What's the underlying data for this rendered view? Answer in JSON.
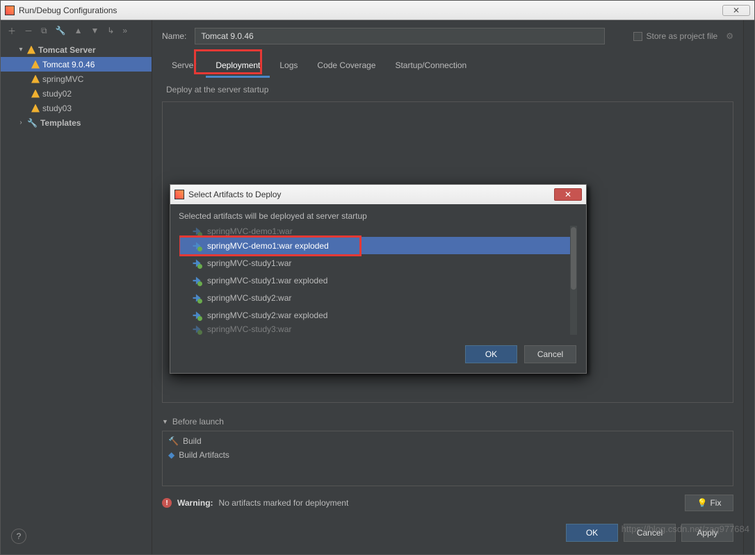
{
  "window": {
    "title": "Run/Debug Configurations",
    "close_glyph": "✕"
  },
  "sidebar": {
    "toolbar_glyphs": [
      "＋",
      "－",
      "⧉",
      "🔧",
      "▲",
      "▼",
      "↳",
      "»"
    ],
    "root": {
      "label": "Tomcat Server",
      "expanded": true
    },
    "configs": [
      {
        "label": "Tomcat 9.0.46",
        "selected": true
      },
      {
        "label": "springMVC",
        "selected": false
      },
      {
        "label": "study02",
        "selected": false
      },
      {
        "label": "study03",
        "selected": false
      }
    ],
    "templates": {
      "label": "Templates",
      "expanded": false
    }
  },
  "header": {
    "name_label": "Name:",
    "name_value": "Tomcat 9.0.46",
    "store_label": "Store as project file",
    "gear_glyph": "⚙"
  },
  "tabs": [
    {
      "label": "Server",
      "active": false
    },
    {
      "label": "Deployment",
      "active": true
    },
    {
      "label": "Logs",
      "active": false
    },
    {
      "label": "Code Coverage",
      "active": false
    },
    {
      "label": "Startup/Connection",
      "active": false
    }
  ],
  "deployment": {
    "section_label": "Deploy at the server startup"
  },
  "before_launch": {
    "title": "Before launch",
    "items": [
      {
        "label": "Build",
        "icon": "hammer"
      },
      {
        "label": "Build Artifacts",
        "icon": "artifact"
      }
    ]
  },
  "warning": {
    "bold": "Warning:",
    "text": "No artifacts marked for deployment",
    "fix_label": "Fix"
  },
  "buttons": {
    "ok": "OK",
    "cancel": "Cancel",
    "apply": "Apply",
    "help_glyph": "?"
  },
  "modal": {
    "title": "Select Artifacts to Deploy",
    "subtitle": "Selected artifacts will be deployed at server startup",
    "items": [
      {
        "label": "springMVC-demo1:war",
        "selected": false,
        "cut_top": true
      },
      {
        "label": "springMVC-demo1:war exploded",
        "selected": true
      },
      {
        "label": "springMVC-study1:war",
        "selected": false
      },
      {
        "label": "springMVC-study1:war exploded",
        "selected": false
      },
      {
        "label": "springMVC-study2:war",
        "selected": false
      },
      {
        "label": "springMVC-study2:war exploded",
        "selected": false
      },
      {
        "label": "springMVC-study3:war",
        "selected": false,
        "cut_bottom": true
      }
    ],
    "ok": "OK",
    "cancel": "Cancel",
    "close_glyph": "✕"
  },
  "watermark": "https://blog.csdn.net/zaq977684"
}
